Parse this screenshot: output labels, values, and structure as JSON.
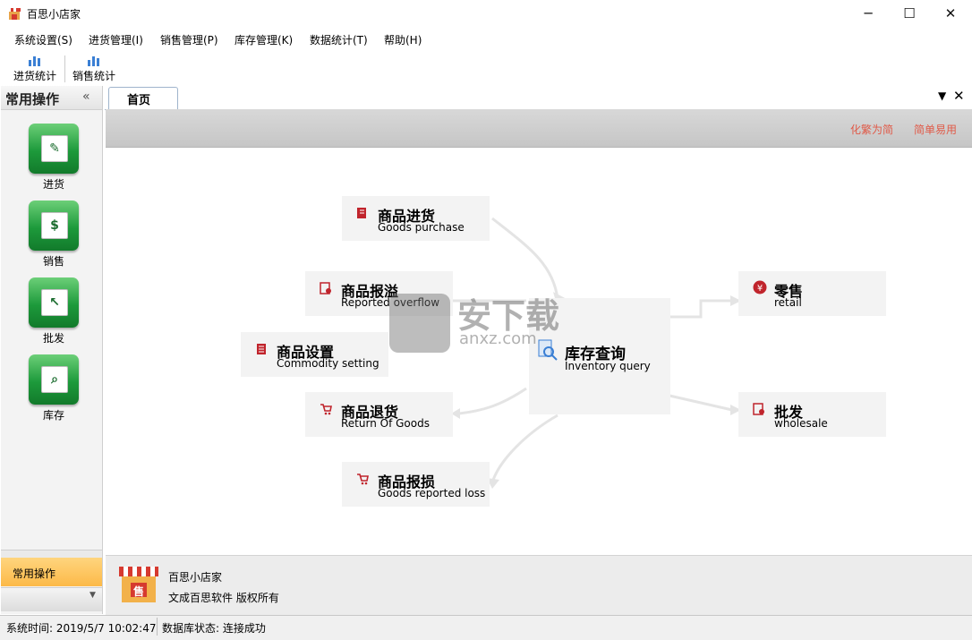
{
  "window": {
    "title": "百思小店家",
    "controls": {
      "minimize": "─",
      "maximize": "☐",
      "close": "✕"
    }
  },
  "menu": [
    "系统设置(S)",
    "进货管理(I)",
    "销售管理(P)",
    "库存管理(K)",
    "数据统计(T)",
    "帮助(H)"
  ],
  "toolbar": {
    "purchase_stats": "进货统计",
    "sales_stats": "销售统计"
  },
  "sidebar": {
    "title": "常用操作",
    "collapse": "«",
    "items": [
      {
        "label": "进货",
        "icon": "purchase-icon"
      },
      {
        "label": "销售",
        "icon": "sales-icon"
      },
      {
        "label": "批发",
        "icon": "wholesale-icon"
      },
      {
        "label": "库存",
        "icon": "inventory-icon"
      }
    ],
    "active_group": "常用操作"
  },
  "tabs": {
    "home": "首页",
    "menu_glyph": "▼",
    "close_glyph": "✕"
  },
  "banner": {
    "link1": "化繁为简",
    "link2": "简单易用"
  },
  "flow": {
    "purchase": {
      "title": "商品进货",
      "sub": "Goods purchase"
    },
    "overflow": {
      "title": "商品报溢",
      "sub": "Reported overflow"
    },
    "setting": {
      "title": "商品设置",
      "sub": "Commodity setting"
    },
    "return": {
      "title": "商品退货",
      "sub": "Return Of Goods"
    },
    "loss": {
      "title": "商品报损",
      "sub": "Goods reported loss"
    },
    "inventory": {
      "title": "库存查询",
      "sub": "Inventory query"
    },
    "retail": {
      "title": "零售",
      "sub": "retail"
    },
    "wholesale": {
      "title": "批发",
      "sub": "wholesale"
    }
  },
  "watermark": {
    "cn": "安下载",
    "en": "anxz.com"
  },
  "footer": {
    "name": "百思小店家",
    "copyright": "文成百思软件  版权所有",
    "logo_char": "售"
  },
  "status": {
    "time": "系统时间:  2019/5/7 10:02:47",
    "db": "数据库状态:  连接成功"
  },
  "colors": {
    "accent_red": "#c0242c",
    "banner_link": "#e05a48",
    "green_button": "#1d9a3b",
    "active_orange": "#fcb948"
  }
}
